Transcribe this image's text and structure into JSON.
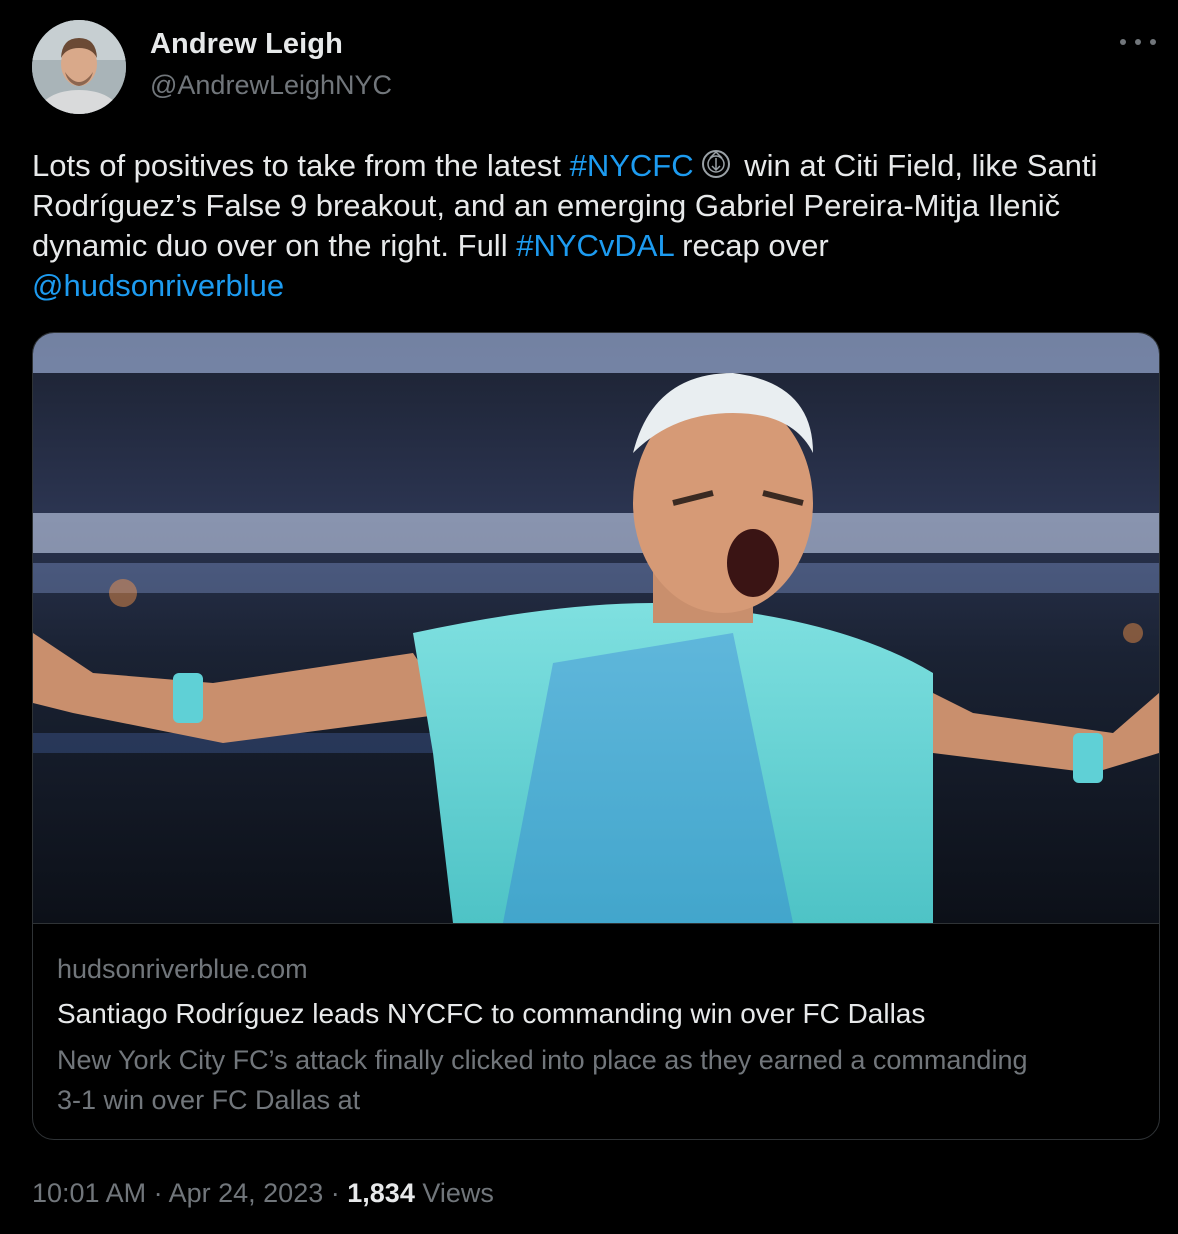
{
  "author": {
    "name": "Andrew Leigh",
    "handle": "@AndrewLeighNYC",
    "avatar_icon": "avatar-photo"
  },
  "menu": {
    "icon": "more-horizontal-icon"
  },
  "tweet": {
    "text_1": "Lots of positives to take from the latest ",
    "hashtag_1": "#NYCFC",
    "emoji_icon": "nycfc-crest-icon",
    "text_2": " win at Citi Field, like Santi Rodríguez’s False 9 breakout, and an emerging Gabriel Pereira-Mitja Ilenič dynamic duo over on the right. Full ",
    "hashtag_2": "#NYCvDAL",
    "text_3": " recap over ",
    "mention": "@hudsonriverblue"
  },
  "card": {
    "image_icon": "article-photo",
    "domain": "hudsonriverblue.com",
    "title": "Santiago Rodríguez leads NYCFC to commanding win over FC Dallas",
    "description": "New York City FC’s attack finally clicked into place as they earned a commanding 3-1 win over FC Dallas at"
  },
  "meta": {
    "time": "10:01 AM",
    "separator": "·",
    "date": "Apr 24, 2023",
    "views_count": "1,834",
    "views_label": "Views"
  },
  "colors": {
    "background": "#000000",
    "text": "#e7e9ea",
    "secondary": "#71767b",
    "link": "#1d9bf0",
    "border": "#2f3336"
  }
}
